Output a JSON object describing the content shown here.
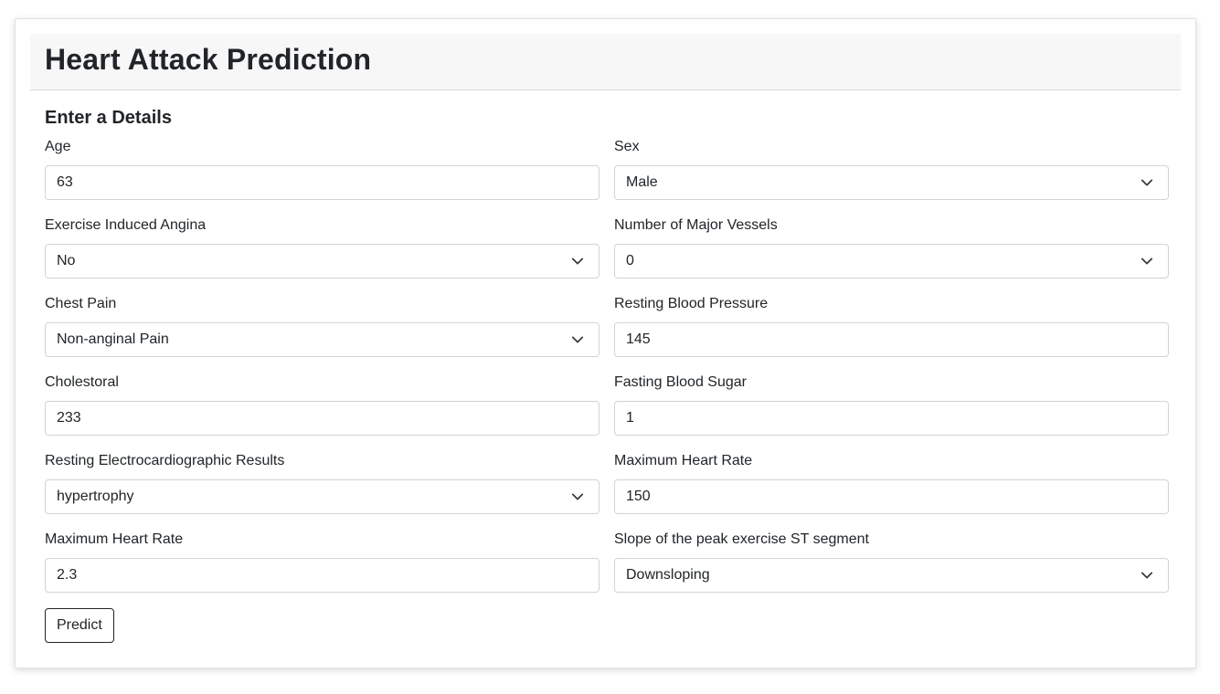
{
  "header": {
    "title": "Heart Attack Prediction"
  },
  "form": {
    "section_title": "Enter a Details",
    "fields": [
      {
        "label": "Age",
        "type": "input",
        "value": "63"
      },
      {
        "label": "Sex",
        "type": "select",
        "value": "Male"
      },
      {
        "label": "Exercise Induced Angina",
        "type": "select",
        "value": "No"
      },
      {
        "label": "Number of Major Vessels",
        "type": "select",
        "value": "0"
      },
      {
        "label": "Chest Pain",
        "type": "select",
        "value": "Non-anginal Pain"
      },
      {
        "label": "Resting Blood Pressure",
        "type": "input",
        "value": "145"
      },
      {
        "label": "Cholestoral",
        "type": "input",
        "value": "233"
      },
      {
        "label": "Fasting Blood Sugar",
        "type": "input",
        "value": "1"
      },
      {
        "label": "Resting Electrocardiographic Results",
        "type": "select",
        "value": "hypertrophy"
      },
      {
        "label": "Maximum Heart Rate",
        "type": "input",
        "value": "150"
      },
      {
        "label": "Maximum Heart Rate",
        "type": "input",
        "value": "2.3"
      },
      {
        "label": "Slope of the peak exercise ST segment",
        "type": "select",
        "value": "Downsloping"
      }
    ],
    "submit_label": "Predict"
  },
  "icons": {
    "select_arrow": "chevron-down-icon"
  },
  "colors": {
    "header_bg": "#f7f7f7",
    "border": "#ced4da",
    "text": "#212529"
  }
}
